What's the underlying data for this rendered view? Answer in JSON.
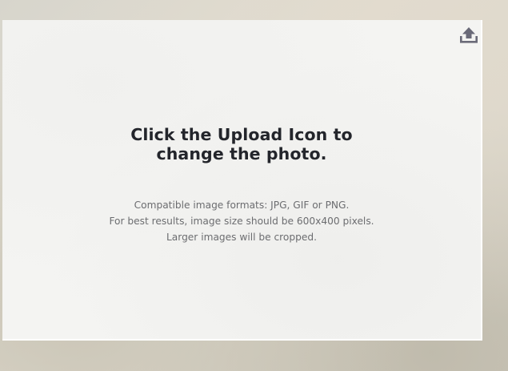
{
  "upload_panel": {
    "upload_icon": "upload-icon",
    "headline_line1": "Click the Upload Icon to",
    "headline_line2": "change the photo.",
    "info_lines": [
      "Compatible image formats: JPG, GIF or PNG.",
      "For best results, image size should be 600x400 pixels.",
      "Larger images will be cropped."
    ]
  },
  "colors": {
    "headline_text": "#23252b",
    "info_text": "#6c6d70",
    "icon": "#6a6a78",
    "card_background": "#f4f4f2"
  }
}
